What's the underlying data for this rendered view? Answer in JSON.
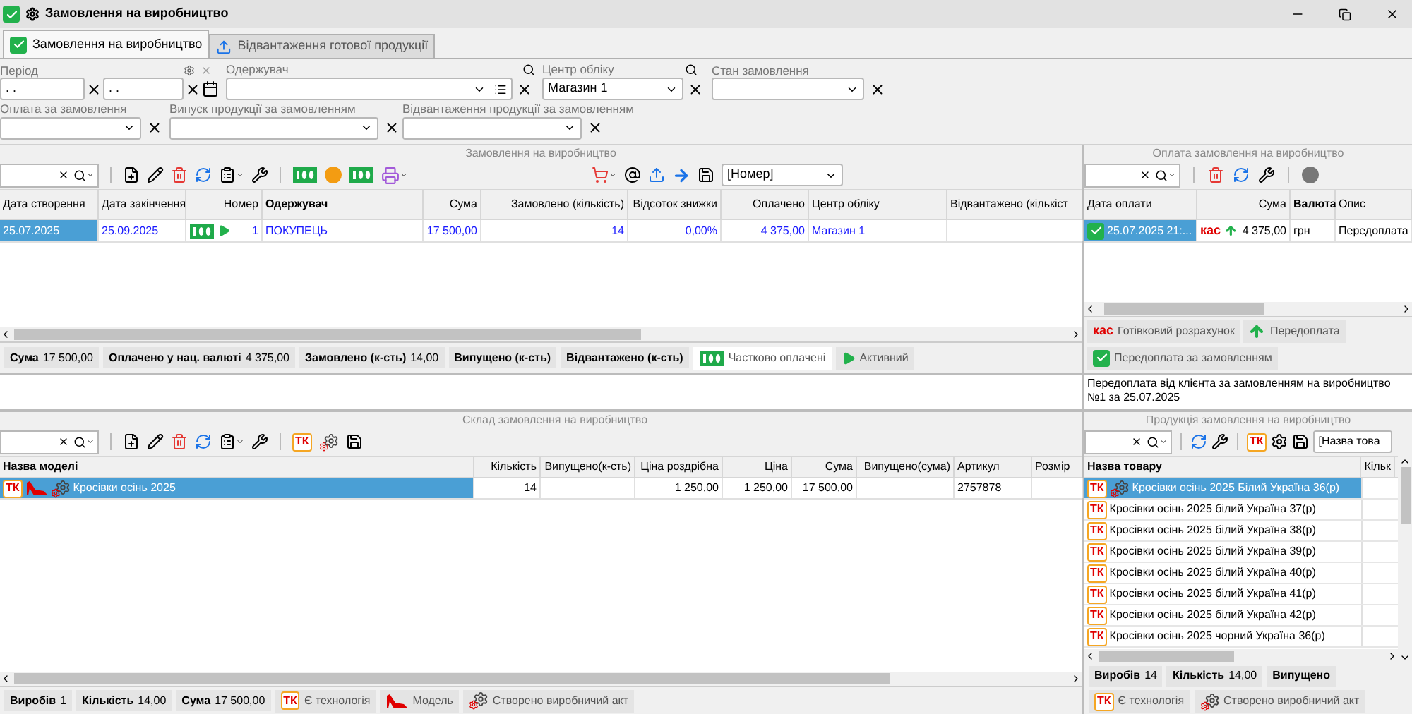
{
  "window": {
    "title": "Замовлення на виробництво"
  },
  "tabs": [
    {
      "label": "Замовлення на виробництво",
      "selected": true
    },
    {
      "label": "Відвантаження готової продукції",
      "selected": false
    }
  ],
  "filters": {
    "period": {
      "label": "Період",
      "from": " . .",
      "to": " . ."
    },
    "recipient": {
      "label": "Одержувач"
    },
    "center": {
      "label": "Центр обліку",
      "value": "Магазин 1"
    },
    "order_state": {
      "label": "Стан замовлення"
    },
    "payment": {
      "label": "Оплата за замовлення"
    },
    "release": {
      "label": "Випуск продукції за замовленням"
    },
    "shipment": {
      "label": "Відвантаження продукції за замовленням"
    }
  },
  "orders": {
    "caption": "Замовлення на виробництво",
    "sort_field": "[Номер]",
    "columns": [
      "Дата створення",
      "Дата закінчення",
      "Номер",
      "Одержувач",
      "Сума",
      "Замовлено (кількість)",
      "Відсоток знижки",
      "Оплачено",
      "Центр обліку",
      "Відвантажено (кількіст"
    ],
    "rows": [
      {
        "selected": true,
        "cells": [
          "25.07.2025",
          "25.09.2025",
          "1",
          "ПОКУПЕЦЬ",
          "17 500,00",
          "14",
          "0,00%",
          "4 375,00",
          "Магазин 1"
        ]
      }
    ],
    "summary": [
      {
        "label": "Сума",
        "value": "17 500,00"
      },
      {
        "label": "Оплачено у нац. валюті",
        "value": "4 375,00"
      },
      {
        "label": "Замовлено (к-сть)",
        "value": "14,00"
      },
      {
        "label": "Випущено (к-сть)"
      },
      {
        "label": "Відвантажено (к-сть)"
      }
    ],
    "legend": [
      {
        "kind": "partial",
        "label": "Частково оплачені"
      },
      {
        "kind": "active",
        "label": "Активний"
      }
    ]
  },
  "payments": {
    "caption": "Оплата замовлення на виробництво",
    "columns": [
      "Дата оплати",
      "Сума",
      "Валюта",
      "Опис"
    ],
    "rows": [
      {
        "selected": true,
        "badge": "кас",
        "cells": [
          "25.07.2025 21:...",
          "4 375,00",
          "грн",
          "Передоплата"
        ]
      }
    ],
    "legend": [
      {
        "kind": "cash",
        "badge": "кас",
        "label": "Готівковий розрахунок"
      },
      {
        "kind": "prepay",
        "label": "Передоплата"
      },
      {
        "kind": "order_prepay",
        "label": "Передоплата за замовленням"
      }
    ],
    "description": "Передоплата від клієнта за замовленням на виробництво №1 за 25.07.2025"
  },
  "composition": {
    "caption": "Склад замовлення на виробництво",
    "toolbar_badge": "ТК",
    "columns": [
      "Назва моделі",
      "Кількість",
      "Випущено(к-сть)",
      "Ціна роздрібна",
      "Ціна",
      "Сума",
      "Випущено(сума)",
      "Артикул",
      "Розмір"
    ],
    "rows": [
      {
        "selected": true,
        "badge": "ТК",
        "cells": [
          "Кросівки осінь 2025",
          "14",
          "",
          "1 250,00",
          "1 250,00",
          "17 500,00",
          "",
          "2757878",
          ""
        ]
      }
    ],
    "summary": [
      {
        "label": "Виробів",
        "value": "1"
      },
      {
        "label": "Кількість",
        "value": "14,00"
      },
      {
        "label": "Сума",
        "value": "17 500,00"
      }
    ],
    "legend": [
      {
        "kind": "tech",
        "badge": "ТК",
        "label": "Є технологія"
      },
      {
        "kind": "model",
        "label": "Модель"
      },
      {
        "kind": "act",
        "label": "Створено виробничий акт"
      }
    ]
  },
  "products": {
    "caption": "Продукція замовлення на виробництво",
    "toolbar_badge": "ТК",
    "sort_field": "[Назва това",
    "columns": [
      "Назва товару",
      "Кільк"
    ],
    "items": [
      {
        "badge": "ТК",
        "name": "Кросівки осінь 2025 Білий Україна 36(р)",
        "act": true,
        "selected": true
      },
      {
        "badge": "ТК",
        "name": "Кросівки осінь 2025 білий Україна 37(р)",
        "act": false,
        "selected": false
      },
      {
        "badge": "ТК",
        "name": "Кросівки осінь 2025 білий Україна 38(р)",
        "act": false,
        "selected": false
      },
      {
        "badge": "ТК",
        "name": "Кросівки осінь 2025 білий Україна 39(р)",
        "act": false,
        "selected": false
      },
      {
        "badge": "ТК",
        "name": "Кросівки осінь 2025 білий Україна 40(р)",
        "act": false,
        "selected": false
      },
      {
        "badge": "ТК",
        "name": "Кросівки осінь 2025 білий Україна 41(р)",
        "act": false,
        "selected": false
      },
      {
        "badge": "ТК",
        "name": "Кросівки осінь 2025 білий Україна 42(р)",
        "act": false,
        "selected": false
      },
      {
        "badge": "ТК",
        "name": "Кросівки осінь 2025 чорний Україна 36(р)",
        "act": false,
        "selected": false
      }
    ],
    "summary": [
      {
        "label": "Виробів",
        "value": "14"
      },
      {
        "label": "Кількість",
        "value": "14,00"
      },
      {
        "label": "Випущено"
      }
    ],
    "legend": [
      {
        "kind": "tech",
        "badge": "ТК",
        "label": "Є технологія"
      },
      {
        "kind": "act",
        "label": "Створено виробничий акт"
      }
    ]
  }
}
